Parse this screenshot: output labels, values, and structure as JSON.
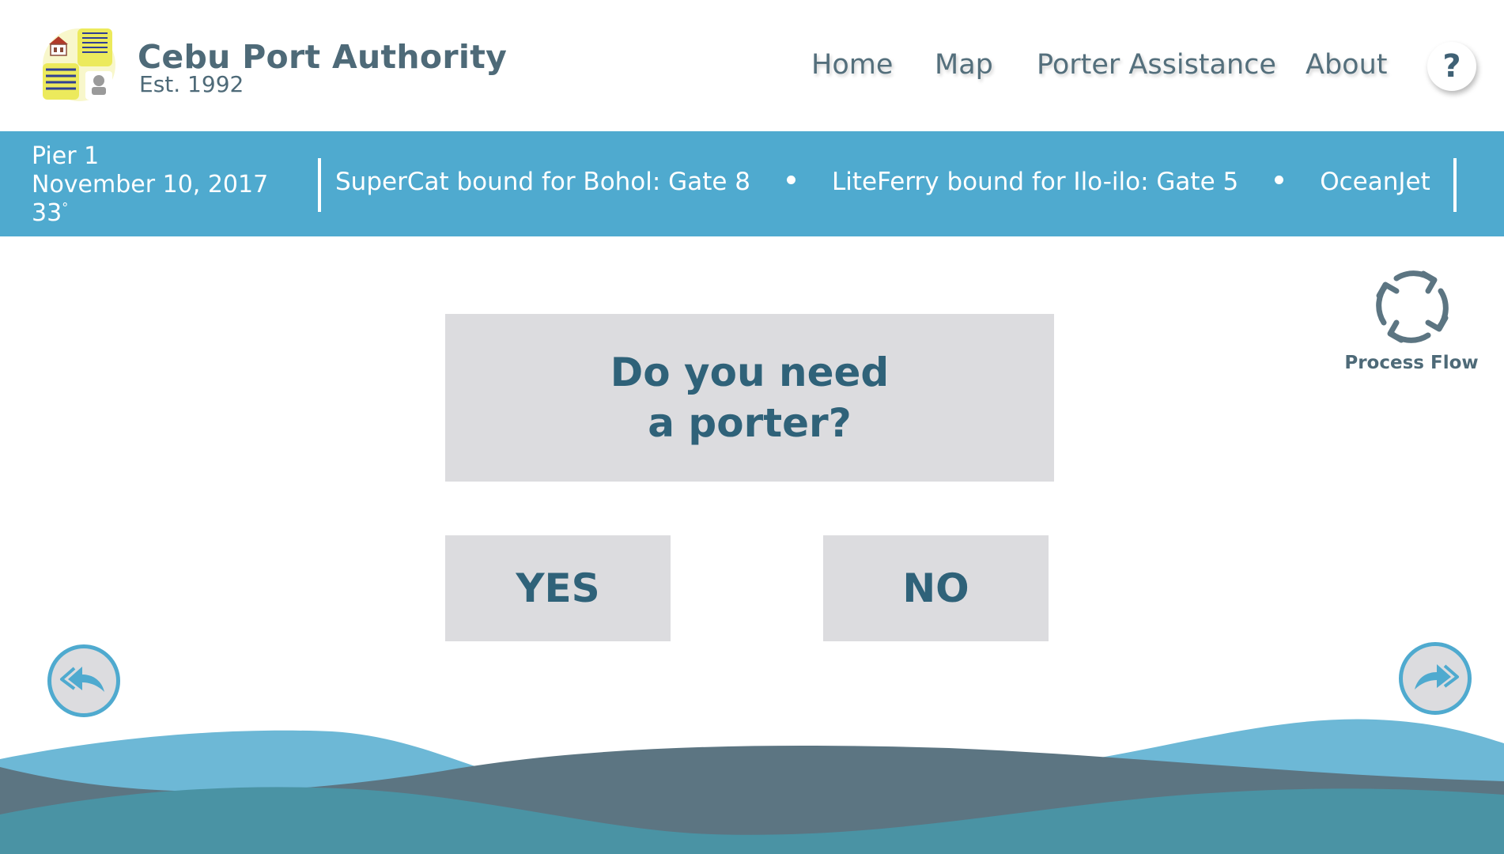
{
  "header": {
    "brand_title": "Cebu Port Authority",
    "brand_subtitle": "Est. 1992",
    "logo_icon": "port-authority-logo",
    "nav": [
      {
        "label": "Home"
      },
      {
        "label": "Map"
      },
      {
        "label": "Porter Assistance"
      },
      {
        "label": "About"
      }
    ],
    "help_label": "?"
  },
  "info_bar": {
    "pier": "Pier 1",
    "date": "November 10, 2017",
    "temperature": "33",
    "temperature_unit": "°",
    "ticker": [
      "SuperCat bound for Bohol: Gate 8",
      "LiteFerry bound for Ilo-ilo: Gate 5",
      "OceanJet"
    ]
  },
  "process_flow": {
    "label": "Process Flow",
    "icon": "cycle-arrows-icon"
  },
  "question": {
    "line1": "Do you need",
    "line2": "a porter?"
  },
  "answers": {
    "yes": "YES",
    "no": "NO"
  },
  "navigation": {
    "back_icon": "back-arrow-icon",
    "forward_icon": "forward-arrow-icon"
  },
  "colors": {
    "accent_blue": "#4faacf",
    "button_gray": "#dcdcdf",
    "text_dark_teal": "#2f6279",
    "wave_slate": "#5c7582",
    "wave_teal": "#4a93a4",
    "wave_light": "#6db8d6"
  }
}
